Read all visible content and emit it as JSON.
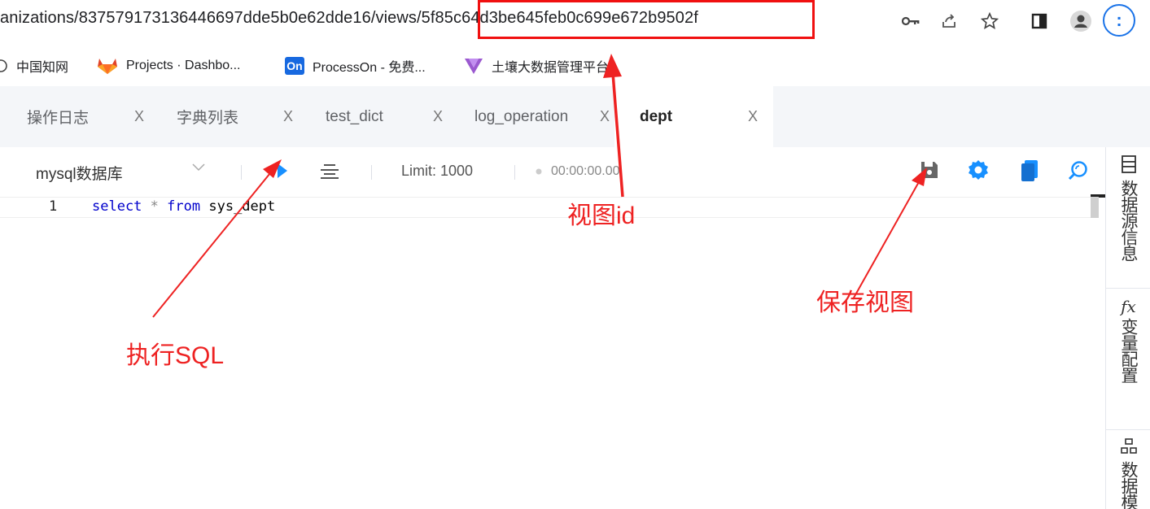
{
  "browser": {
    "url": "anizations/837579173136446697dde5b0e62dde16/views/5f85c64d3be645feb0c699e672b9502f",
    "toolbar_icons": [
      "key-icon",
      "share-icon",
      "star-icon",
      "side-panel-icon",
      "profile-icon",
      "menu-icon"
    ],
    "menu_label": ":"
  },
  "bookmarks": [
    {
      "label": "中国知网",
      "icon": "globe-icon"
    },
    {
      "label": "Projects · Dashbo...",
      "icon": "gitlab-icon"
    },
    {
      "label": "ProcessOn - 免费...",
      "icon": "processon-icon",
      "icon_text": "On"
    },
    {
      "label": "土壤大数据管理平台",
      "icon": "vuetify-icon"
    }
  ],
  "tabs": [
    {
      "label": "操作日志",
      "close": "X",
      "active": false
    },
    {
      "label": "字典列表",
      "close": "X",
      "active": false
    },
    {
      "label": "test_dict",
      "close": "X",
      "active": false
    },
    {
      "label": "log_operation",
      "close": "X",
      "active": false
    },
    {
      "label": "dept",
      "close": "X",
      "active": true
    }
  ],
  "toolbar": {
    "datasource": "mysql数据库",
    "limit": "Limit: 1000",
    "timer": "00:00:00.00",
    "icons": [
      "run-icon",
      "format-icon",
      "save-icon",
      "settings-icon",
      "copy-icon",
      "search-icon"
    ]
  },
  "editor": {
    "line_number": "1",
    "code_tokens": [
      {
        "text": "select",
        "cls": "kw"
      },
      {
        "text": " ",
        "cls": "id"
      },
      {
        "text": "*",
        "cls": "op"
      },
      {
        "text": " ",
        "cls": "id"
      },
      {
        "text": "from",
        "cls": "kw"
      },
      {
        "text": " sys_dept",
        "cls": "id"
      }
    ]
  },
  "side_panel": [
    {
      "icon": "datasource-icon",
      "label": "数据源信息"
    },
    {
      "icon": "fx-icon",
      "icon_text": "fx",
      "label": "变量配置"
    },
    {
      "icon": "model-icon",
      "label": "数据模"
    }
  ],
  "annotations": {
    "view_id": "视图id",
    "run_sql": "执行SQL",
    "save_view": "保存视图",
    "color": "#ee2222"
  },
  "colors": {
    "accent_blue": "#1890ff",
    "annotation_red": "#ee2222",
    "tab_bg": "#f4f6f9"
  }
}
